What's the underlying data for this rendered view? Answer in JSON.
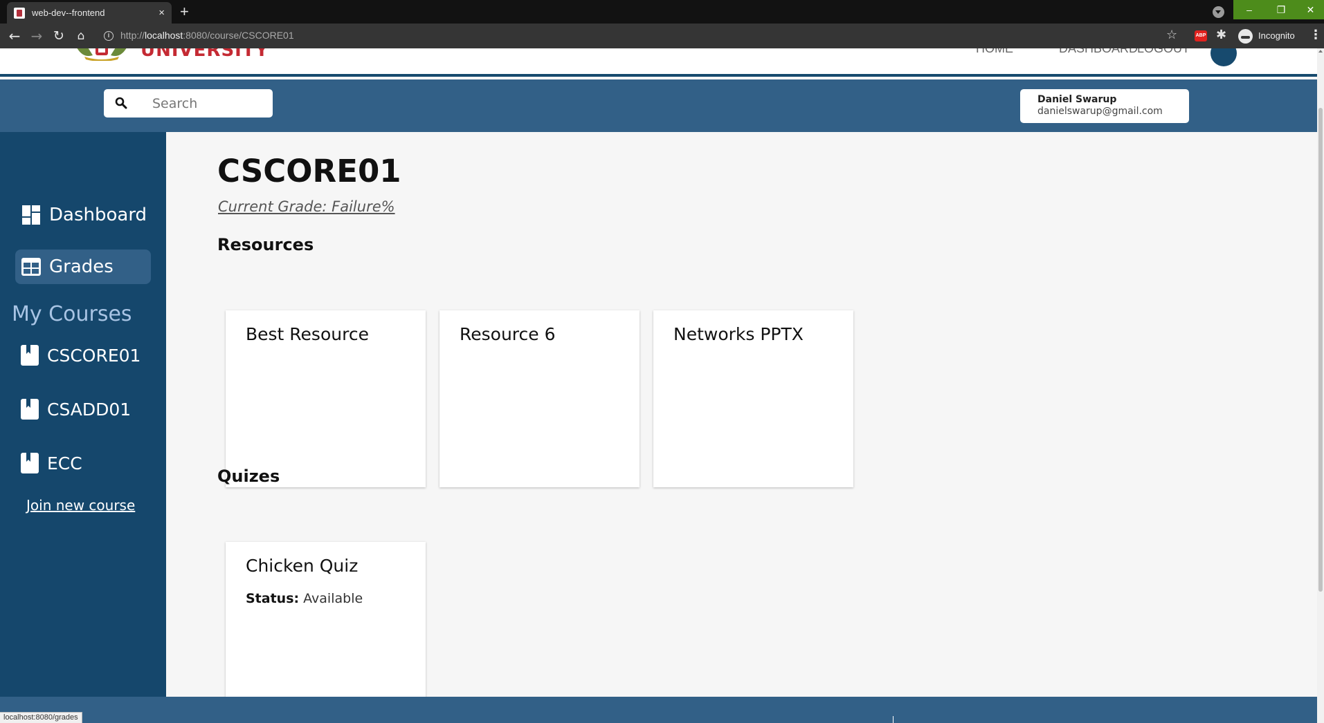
{
  "browser": {
    "tab_title": "web-dev--frontend",
    "tab_close": "×",
    "new_tab": "+",
    "url_prefix": "http://",
    "url_host": "localhost",
    "url_path": ":8080/course/CSCORE01",
    "profile_label": "Incognito",
    "extension_abp": "ABP",
    "window_controls": {
      "minimize": "–",
      "maximize": "❐",
      "close": "✕"
    },
    "status_url": "localhost:8080/grades"
  },
  "header": {
    "logo_text": "UNIVERSITY",
    "nav_links": [
      "HOME",
      "DASHBOARD",
      "LOGOUT"
    ]
  },
  "search": {
    "placeholder": "Search",
    "value": ""
  },
  "user": {
    "name": "Daniel Swarup",
    "email": "danielswarup@gmail.com"
  },
  "sidebar": {
    "dashboard_label": "Dashboard",
    "grades_label": "Grades",
    "my_courses_heading": "My Courses",
    "courses": [
      "CSCORE01",
      "CSADD01",
      "ECC"
    ],
    "join_label": "Join new course"
  },
  "course": {
    "title": "CSCORE01",
    "current_grade": "Current Grade: Failure%",
    "resources_heading": "Resources",
    "resources": [
      {
        "title": "Best Resource"
      },
      {
        "title": "Resource 6"
      },
      {
        "title": "Networks PPTX"
      }
    ],
    "quizzes_heading": "Quizes",
    "quizzes": [
      {
        "title": "Chicken Quiz",
        "status_label": "Status:",
        "status_value": "Available"
      }
    ]
  },
  "colors": {
    "sidebar": "#15476c",
    "searchbar": "#326087",
    "logo_red": "#c42a33"
  }
}
